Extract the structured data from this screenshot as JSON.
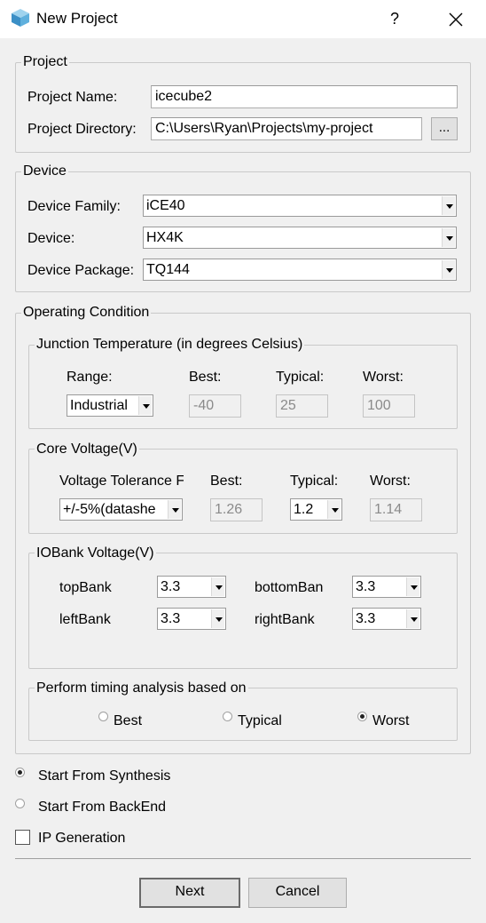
{
  "window": {
    "title": "New Project",
    "help_label": "?",
    "close_label": "✕"
  },
  "project": {
    "group_title": "Project",
    "name_label": "Project Name:",
    "name_value": "icecube2",
    "directory_label": "Project Directory:",
    "directory_value": "C:\\Users\\Ryan\\Projects\\my-project",
    "browse_label": "..."
  },
  "device": {
    "group_title": "Device",
    "family_label": "Device Family:",
    "family_value": "iCE40",
    "device_label": "Device:",
    "device_value": "HX4K",
    "package_label": "Device Package:",
    "package_value": "TQ144"
  },
  "operating": {
    "group_title": "Operating Condition",
    "junction": {
      "group_title": "Junction Temperature (in degrees Celsius)",
      "range_label": "Range:",
      "best_label": "Best:",
      "typical_label": "Typical:",
      "worst_label": "Worst:",
      "range_value": "Industrial",
      "best_value": "-40",
      "typical_value": "25",
      "worst_value": "100"
    },
    "core": {
      "group_title": "Core Voltage(V)",
      "tolerance_label": "Voltage Tolerance F",
      "best_label": "Best:",
      "typical_label": "Typical:",
      "worst_label": "Worst:",
      "tolerance_value": "+/-5%(datashe",
      "best_value": "1.26",
      "typical_value": "1.2",
      "worst_value": "1.14"
    },
    "iobank": {
      "group_title": "IOBank Voltage(V)",
      "top_label": "topBank",
      "top_value": "3.3",
      "bottom_label": "bottomBan",
      "bottom_value": "3.3",
      "left_label": "leftBank",
      "left_value": "3.3",
      "right_label": "rightBank",
      "right_value": "3.3"
    },
    "timing": {
      "group_title": "Perform timing analysis based on",
      "best_label": "Best",
      "typical_label": "Typical",
      "worst_label": "Worst",
      "selected": "Worst"
    }
  },
  "start_options": {
    "synthesis_label": "Start From Synthesis",
    "backend_label": "Start From BackEnd",
    "selected": "Start From Synthesis",
    "ip_generation_label": "IP Generation",
    "ip_generation_checked": false
  },
  "buttons": {
    "next_label": "Next",
    "cancel_label": "Cancel"
  },
  "colors": {
    "background": "#f0f0f0",
    "titlebar": "#ffffff",
    "border": "#c9c9c9"
  }
}
